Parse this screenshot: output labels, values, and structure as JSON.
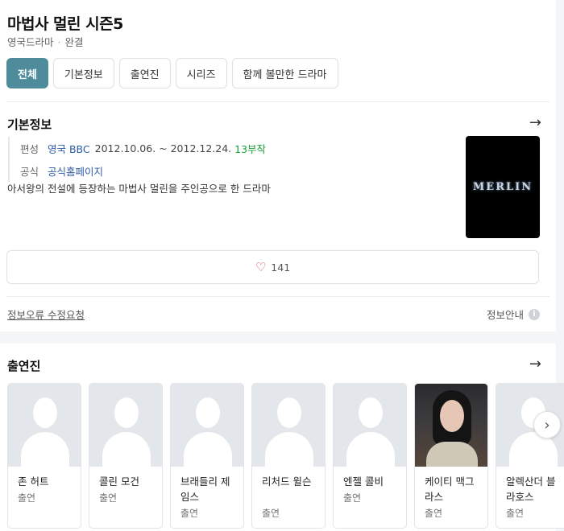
{
  "header": {
    "title": "마법사 멀린 시즌5",
    "country": "영국드라마",
    "status": "완결"
  },
  "tabs": [
    {
      "label": "전체",
      "active": true
    },
    {
      "label": "기본정보",
      "active": false
    },
    {
      "label": "출연진",
      "active": false
    },
    {
      "label": "시리즈",
      "active": false
    },
    {
      "label": "함께 볼만한 드라마",
      "active": false
    }
  ],
  "basic_info": {
    "title": "기본정보",
    "schedule_label": "편성",
    "broadcaster": "영국 BBC",
    "dates": "2012.10.06. ~ 2012.12.24.",
    "episodes": "13부작",
    "official_label": "공식",
    "official_link": "공식홈페이지",
    "description": "아서왕의 전설에 등장하는 마법사 멀린을 주인공으로 한 드라마",
    "poster_text": "MERLIN",
    "likes": "141",
    "report_link": "정보오류 수정요청",
    "guide_link": "정보안내"
  },
  "cast": {
    "title": "출연진",
    "members": [
      {
        "name": "존 허트",
        "role": "출연"
      },
      {
        "name": "콜린 모건",
        "role": "출연"
      },
      {
        "name": "브래들리 제임스",
        "role": "출연"
      },
      {
        "name": "리처드 윌슨",
        "role": "출연"
      },
      {
        "name": "엔젤 콜비",
        "role": "출연"
      },
      {
        "name": "케이티 맥그라스",
        "role": "출연"
      },
      {
        "name": "알렉산더 블라호스",
        "role": "출연"
      }
    ]
  },
  "colors": {
    "accent": "#4e8c9c",
    "link": "#2d5aa6",
    "episodes": "#1a9e3a",
    "heart": "#e0474c"
  }
}
